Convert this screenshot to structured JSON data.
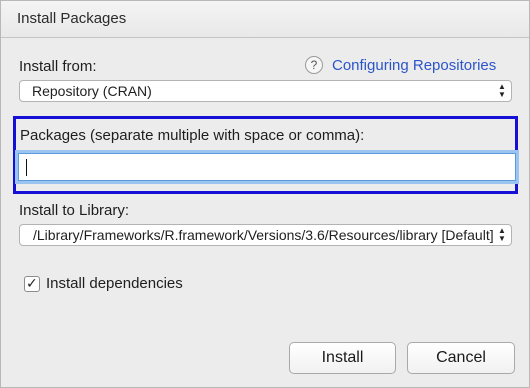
{
  "window": {
    "title": "Install Packages"
  },
  "install_from": {
    "label": "Install from:",
    "help_icon": "question-mark-icon",
    "help_glyph": "?",
    "help_link": "Configuring Repositories",
    "selected": "Repository (CRAN)"
  },
  "packages": {
    "label": "Packages (separate multiple with space or comma):",
    "value": ""
  },
  "library": {
    "label": "Install to Library:",
    "selected": "/Library/Frameworks/R.framework/Versions/3.6/Resources/library [Default]"
  },
  "dependencies": {
    "label": "Install dependencies",
    "checked": true,
    "check_glyph": "✓"
  },
  "buttons": {
    "install": "Install",
    "cancel": "Cancel"
  },
  "colors": {
    "link": "#2b55c9",
    "highlight_border": "#1510d6",
    "focus_ring": "#9cc4f0"
  }
}
